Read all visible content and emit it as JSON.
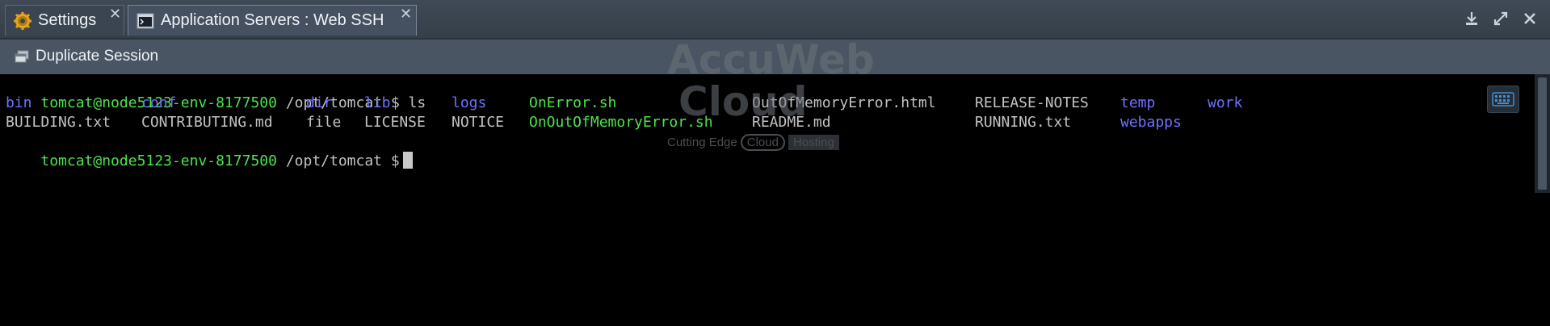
{
  "tabs": [
    {
      "label": "Settings",
      "icon": "gear-icon",
      "active": false
    },
    {
      "label": "Application Servers : Web SSH",
      "icon": "terminal-icon",
      "active": true
    }
  ],
  "window_controls": [
    "download-icon",
    "expand-icon",
    "close-icon"
  ],
  "toolbar": {
    "duplicate_label": "Duplicate Session"
  },
  "terminal": {
    "prompt_user": "tomcat@node5123-env-8177500",
    "prompt_path": "/opt/tomcat $",
    "command": "ls",
    "row1": {
      "bin": "bin",
      "conf": "conf",
      "dir": "dir",
      "lib": "lib",
      "logs": "logs",
      "onerror": "OnError.sh",
      "oom_html": "OutOfMemoryError.html",
      "release": "RELEASE-NOTES",
      "temp": "temp",
      "work": "work"
    },
    "row2": {
      "building": "BUILDING.txt",
      "contributing": "CONTRIBUTING.md",
      "file": "file",
      "license": "LICENSE",
      "notice": "NOTICE",
      "onoom": "OnOutOfMemoryError.sh",
      "readme": "README.md",
      "running": "RUNNING.txt",
      "webapps": "webapps"
    }
  },
  "watermark": {
    "line1": "AccuWeb",
    "line2": "Cloud",
    "tag_cutting": "Cutting Edge",
    "tag_cloud": "Cloud",
    "tag_hosting": "Hosting"
  },
  "colors": {
    "executable": "#4ce34c",
    "directory": "#7070ff",
    "file": "#c2c2c2",
    "tabbar": "#3a4551"
  }
}
